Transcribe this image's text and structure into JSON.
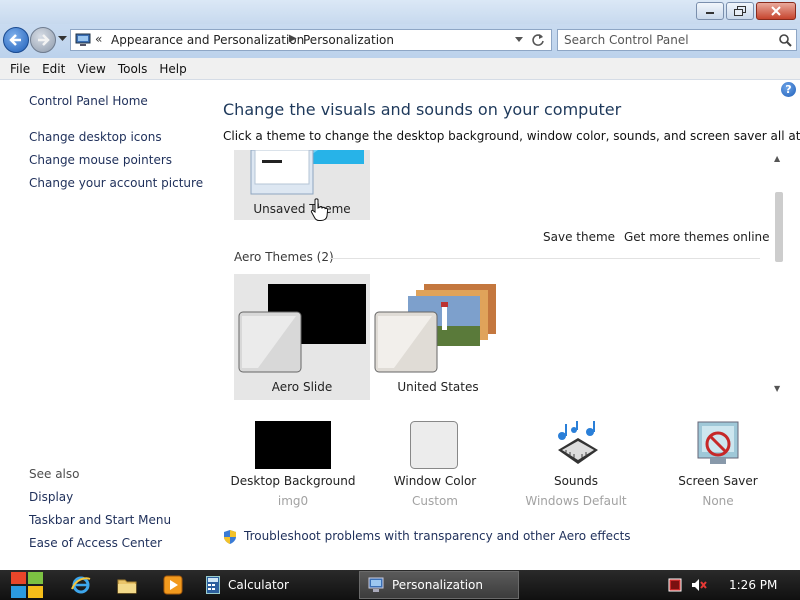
{
  "window": {
    "minimize_icon": "minimize-icon",
    "restore_icon": "restore-icon",
    "close_icon": "close-icon"
  },
  "nav": {
    "breadcrumb_chevron": "«",
    "breadcrumb_1": "Appearance and Personalization",
    "breadcrumb_sep": "▶",
    "breadcrumb_2": "Personalization",
    "search_placeholder": "Search Control Panel"
  },
  "menu": [
    "File",
    "Edit",
    "View",
    "Tools",
    "Help"
  ],
  "left_pane": {
    "home": "Control Panel Home",
    "links": [
      "Change desktop icons",
      "Change mouse pointers",
      "Change your account picture"
    ],
    "see_also_heading": "See also",
    "see_also": [
      "Display",
      "Taskbar and Start Menu",
      "Ease of Access Center"
    ]
  },
  "help_label": "?",
  "main": {
    "title": "Change the visuals and sounds on your computer",
    "subtitle": "Click a theme to change the desktop background, window color, sounds, and screen saver all at once."
  },
  "themes": {
    "unsaved": "Unsaved Theme",
    "save_theme": "Save theme",
    "get_more": "Get more themes online",
    "group_heading": "Aero Themes (2)",
    "items": [
      "Aero Slide",
      "United States"
    ]
  },
  "settings": [
    {
      "label": "Desktop Background",
      "value": "img0"
    },
    {
      "label": "Window Color",
      "value": "Custom"
    },
    {
      "label": "Sounds",
      "value": "Windows Default"
    },
    {
      "label": "Screen Saver",
      "value": "None"
    }
  ],
  "troubleshoot": "Troubleshoot problems with transparency and other Aero effects",
  "taskbar": {
    "tasks": [
      "Calculator",
      "Personalization"
    ],
    "clock": "1:26 PM"
  },
  "colors": {
    "link": "#1e2f5a",
    "title": "#1e395b",
    "taskbar": "#1a1a1a",
    "selected_tile": "#e6e6e6"
  }
}
